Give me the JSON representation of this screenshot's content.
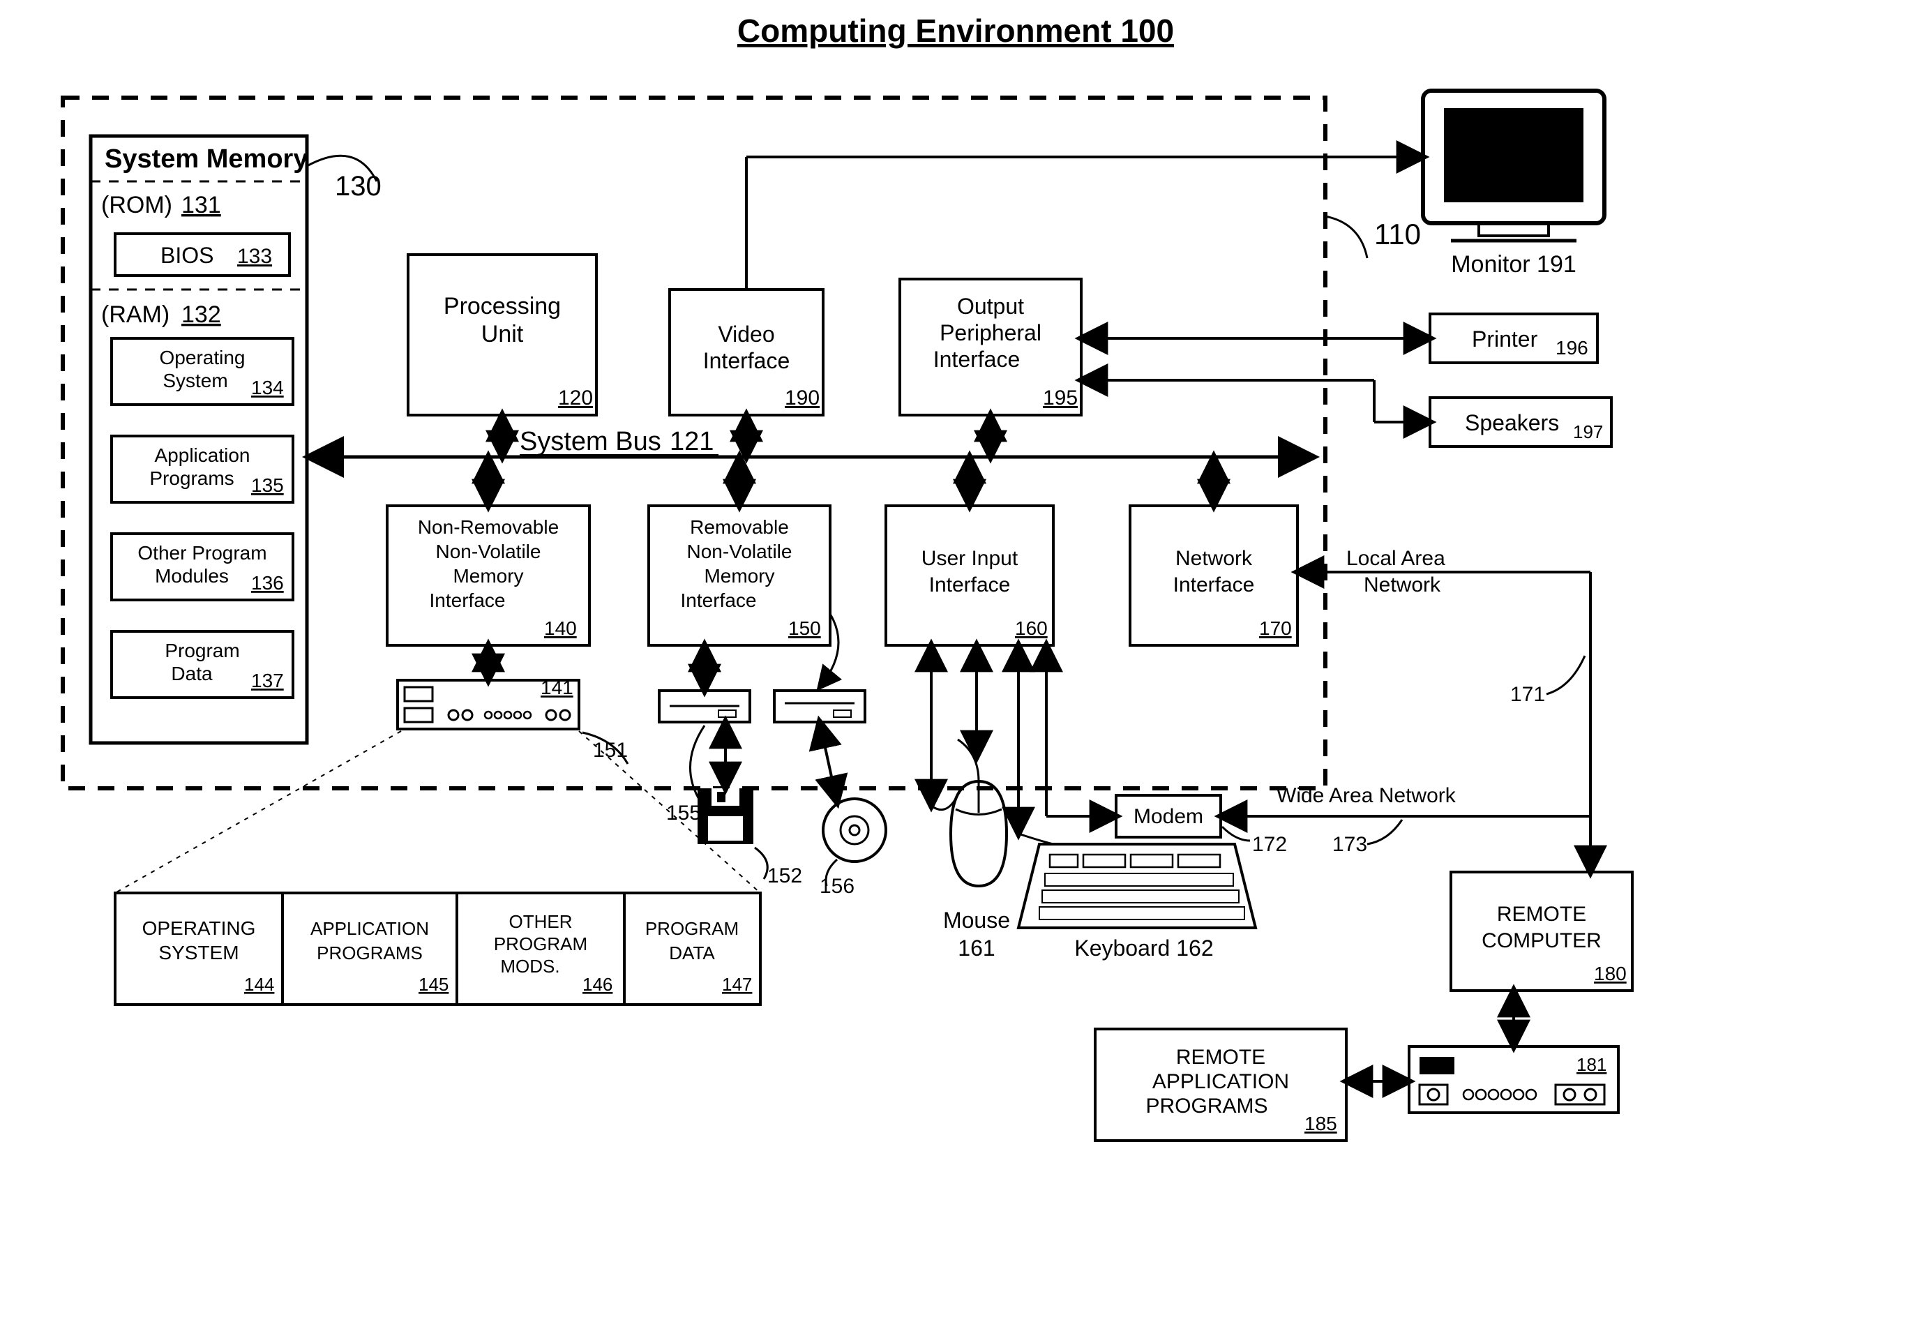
{
  "title": "Computing Environment 100",
  "computer_label": "110",
  "system_memory": {
    "header": "System Memory",
    "ref": "130",
    "rom": {
      "label": "(ROM)",
      "ref": "131"
    },
    "bios": {
      "label": "BIOS",
      "ref": "133"
    },
    "ram": {
      "label": "(RAM)",
      "ref": "132"
    },
    "os": {
      "label": "Operating System",
      "ref": "134"
    },
    "apps": {
      "label": "Application Programs",
      "ref": "135"
    },
    "other": {
      "label": "Other Program Modules",
      "ref": "136"
    },
    "pdata": {
      "label": "Program Data",
      "ref": "137"
    }
  },
  "bus": {
    "label": "System Bus",
    "ref": "121"
  },
  "processing_unit": {
    "label": "Processing Unit",
    "ref": "120"
  },
  "video_if": {
    "label": "Video Interface",
    "ref": "190"
  },
  "out_periph_if": {
    "label": "Output Peripheral Interface",
    "ref": "195"
  },
  "nonrem_if": {
    "label": "Non-Removable Non-Volatile Memory Interface",
    "ref": "140"
  },
  "rem_if": {
    "label": "Removable Non-Volatile Memory Interface",
    "ref": "150"
  },
  "user_if": {
    "label": "User Input Interface",
    "ref": "160"
  },
  "net_if": {
    "label": "Network Interface",
    "ref": "170"
  },
  "hdd": {
    "ref": "141",
    "drive_ref": "151"
  },
  "floppy": {
    "ref": "152",
    "drive_ref": "155"
  },
  "cd": {
    "ref": "156"
  },
  "mouse": {
    "label": "Mouse",
    "ref": "161"
  },
  "keyboard": {
    "label": "Keyboard",
    "ref": "162"
  },
  "modem": {
    "label": "Modem",
    "ref": "172"
  },
  "lan": {
    "label": "Local Area Network",
    "ref": "171"
  },
  "wan": {
    "label": "Wide Area Network",
    "ref": "173"
  },
  "monitor": {
    "label": "Monitor",
    "ref": "191"
  },
  "printer": {
    "label": "Printer",
    "ref": "196"
  },
  "speakers": {
    "label": "Speakers",
    "ref": "197"
  },
  "remote_pc": {
    "label": "REMOTE COMPUTER",
    "ref": "180"
  },
  "remote_apps": {
    "label": "REMOTE APPLICATION PROGRAMS",
    "ref": "185"
  },
  "remote_media": {
    "ref": "181"
  },
  "hdd_table": {
    "os": {
      "label": "OPERATING SYSTEM",
      "ref": "144"
    },
    "apps": {
      "label": "APPLICATION PROGRAMS",
      "ref": "145"
    },
    "other": {
      "label": "OTHER PROGRAM MODS.",
      "ref": "146"
    },
    "pdata": {
      "label": "PROGRAM DATA",
      "ref": "147"
    }
  }
}
